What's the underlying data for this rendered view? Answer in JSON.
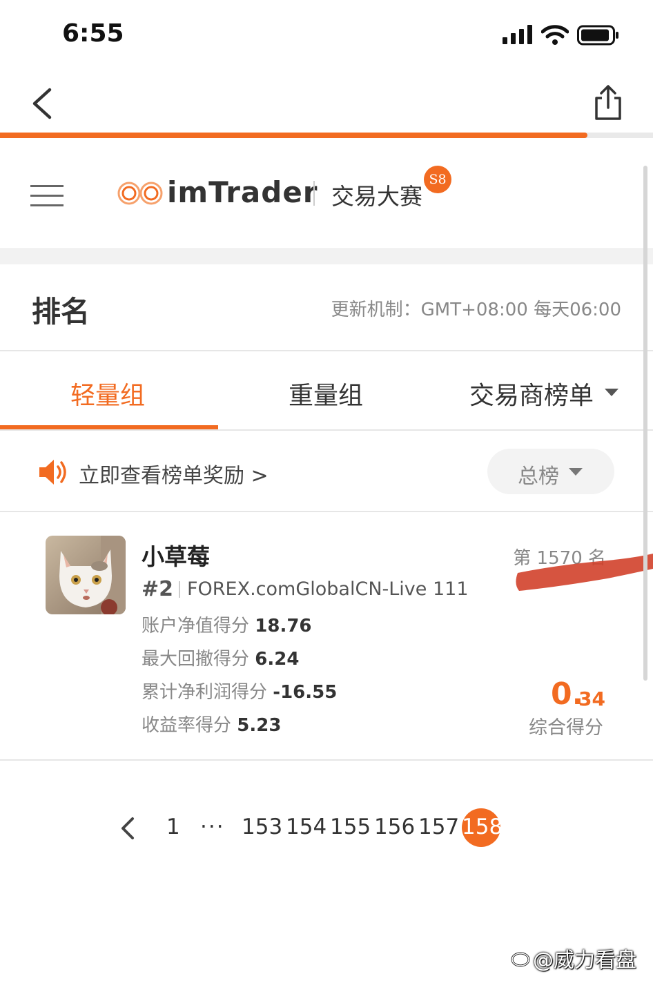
{
  "status_bar": {
    "time": "6:55"
  },
  "nav": {
    "progress_fraction": 0.9
  },
  "brand": {
    "name": "imTrader",
    "contest": "交易大赛",
    "season": "S8"
  },
  "ranking": {
    "title": "排名",
    "update_rule": "更新机制：GMT+08:00 每天06:00"
  },
  "tabs": [
    {
      "label": "轻量组",
      "active": true
    },
    {
      "label": "重量组",
      "active": false
    },
    {
      "label": "交易商榜单",
      "active": false
    }
  ],
  "rewards": {
    "link_label": "立即查看榜单奖励 >",
    "filter_label": "总榜"
  },
  "entry": {
    "name": "小草莓",
    "rank": "#2",
    "server": "FOREX.comGlobalCN-Live 111",
    "metrics": [
      {
        "label": "账户净值得分",
        "value": "18.76"
      },
      {
        "label": "最大回撤得分",
        "value": "6.24"
      },
      {
        "label": "累计净利润得分",
        "value": "-16.55"
      },
      {
        "label": "收益率得分",
        "value": "5.23"
      }
    ],
    "position": "第 1570 名",
    "score_int": "0.",
    "score_dec": "34",
    "score_label": "综合得分"
  },
  "pagination": {
    "pages": [
      "1",
      "···",
      "153",
      "154",
      "155",
      "156",
      "157"
    ],
    "current": "158"
  },
  "watermark": "@威力看盘",
  "colors": {
    "accent": "#f26b21",
    "text": "#333333",
    "muted": "#888888"
  }
}
